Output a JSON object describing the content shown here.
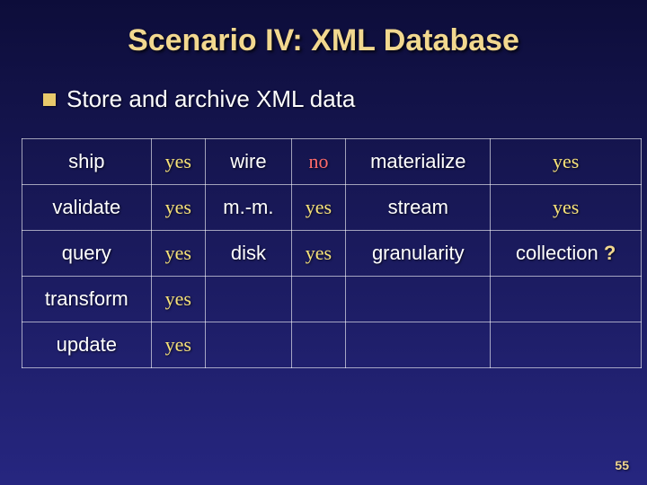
{
  "title": "Scenario IV: XML Database",
  "bullet": "Store and archive XML data",
  "page_number": "55",
  "table": {
    "rows": [
      {
        "l1": "ship",
        "v1": "yes",
        "l2": "wire",
        "v2": "no",
        "l3": "materialize",
        "v3": "yes"
      },
      {
        "l1": "validate",
        "v1": "yes",
        "l2": "m.-m.",
        "v2": "yes",
        "l3": "stream",
        "v3": "yes"
      },
      {
        "l1": "query",
        "v1": "yes",
        "l2": "disk",
        "v2": "yes",
        "l3": "granularity",
        "v3": "collection",
        "q": "?"
      },
      {
        "l1": "transform",
        "v1": "yes",
        "l2": "",
        "v2": "",
        "l3": "",
        "v3": ""
      },
      {
        "l1": "update",
        "v1": "yes",
        "l2": "",
        "v2": "",
        "l3": "",
        "v3": ""
      }
    ]
  }
}
